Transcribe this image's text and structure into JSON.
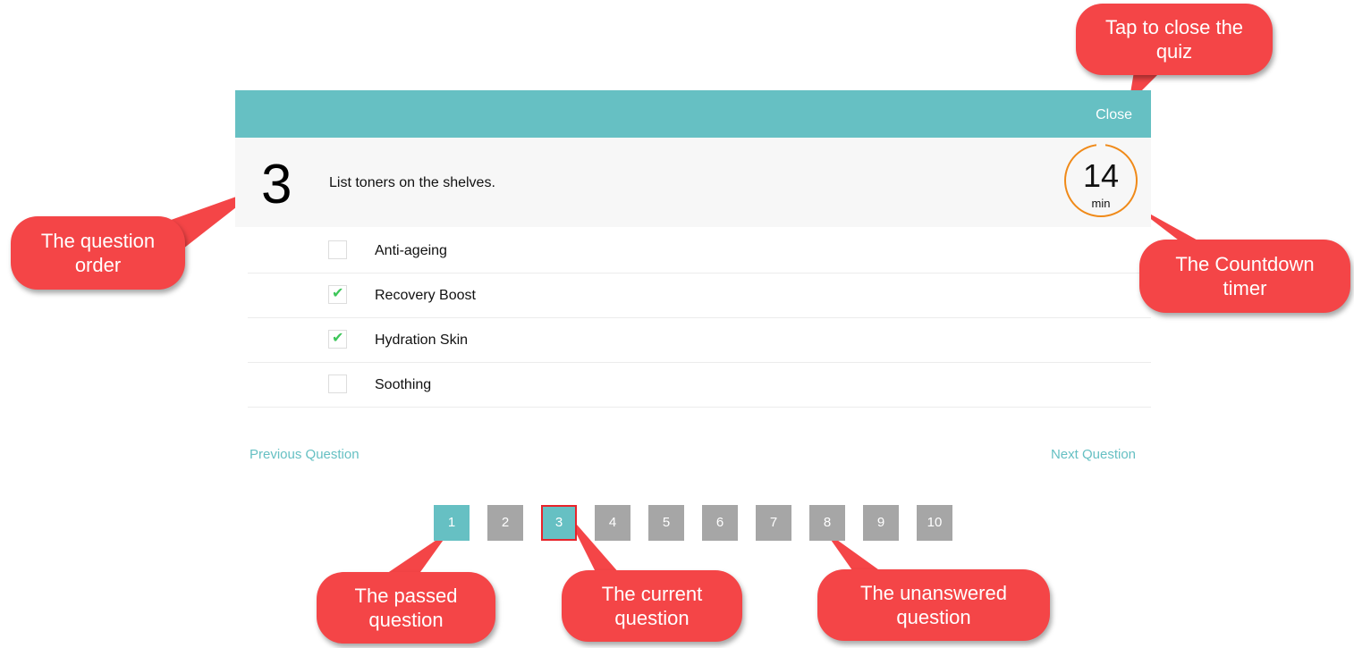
{
  "colors": {
    "accent": "#66c0c3",
    "timer_ring": "#f08a19",
    "callout": "#f44547",
    "unanswered": "#a6a6a6",
    "check": "#3ec65a"
  },
  "header": {
    "close_label": "Close"
  },
  "question": {
    "number": "3",
    "text": "List toners on the shelves."
  },
  "timer": {
    "value": "14",
    "unit": "min"
  },
  "options": [
    {
      "label": "Anti-ageing",
      "checked": false
    },
    {
      "label": "Recovery Boost",
      "checked": true
    },
    {
      "label": "Hydration Skin",
      "checked": true
    },
    {
      "label": "Soothing",
      "checked": false
    }
  ],
  "navigation": {
    "prev_label": "Previous Question",
    "next_label": "Next Question"
  },
  "pager": [
    {
      "label": "1",
      "state": "passed"
    },
    {
      "label": "2",
      "state": "unanswered"
    },
    {
      "label": "3",
      "state": "current"
    },
    {
      "label": "4",
      "state": "unanswered"
    },
    {
      "label": "5",
      "state": "unanswered"
    },
    {
      "label": "6",
      "state": "unanswered"
    },
    {
      "label": "7",
      "state": "unanswered"
    },
    {
      "label": "8",
      "state": "unanswered"
    },
    {
      "label": "9",
      "state": "unanswered"
    },
    {
      "label": "10",
      "state": "unanswered"
    }
  ],
  "callouts": {
    "close": "Tap to close the quiz",
    "order": "The question order",
    "timer": "The Countdown timer",
    "passed": "The passed question",
    "current": "The current question",
    "unanswered": "The unanswered question"
  },
  "icons": {
    "check": "check-icon"
  }
}
